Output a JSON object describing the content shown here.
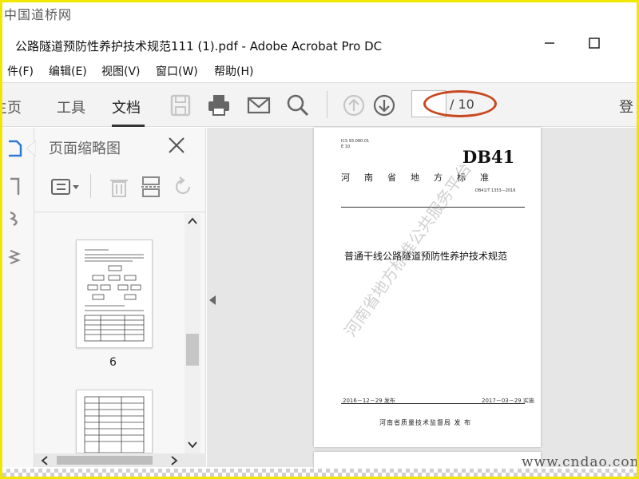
{
  "watermark": {
    "top": "中国道桥网",
    "bottom": "www.cndao.com"
  },
  "window": {
    "title": "公路隧道预防性养护技术规范111 (1).pdf - Adobe Acrobat Pro DC"
  },
  "menu": [
    "件(F)",
    "编辑(E)",
    "视图(V)",
    "窗口(W)",
    "帮助(H)"
  ],
  "toolbar": {
    "tabs": [
      "主页",
      "工具",
      "文档"
    ],
    "active_tab": "文档",
    "page_total": "/ 10",
    "login": "登"
  },
  "panel": {
    "title": "页面缩略图",
    "thumb_label": "6"
  },
  "document": {
    "header_small_1": "ICS 93.080.01",
    "header_small_2": "E 10",
    "logo": "DB41",
    "province": "河南省地方标准",
    "code": "DB41/T 1353—2016",
    "title": "普通干线公路隧道预防性养护技术规范",
    "release_date": "2016－12－29 发布",
    "implement_date": "2017－03－29 实施",
    "issuer": "河南省质量技术监督局  发 布",
    "stamp": "河南省地方标准公共服务平台"
  },
  "colors": {
    "annotation": "#c8491f",
    "frame": "#f2e600",
    "active_underline": "#333333"
  }
}
